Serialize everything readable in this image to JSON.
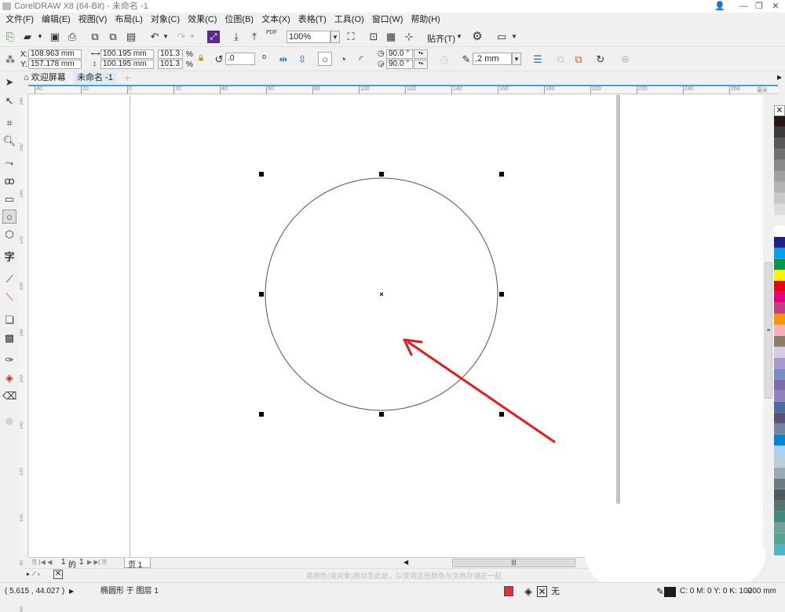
{
  "window": {
    "title": "CorelDRAW X8 (64-Bit) - 未命名 -1"
  },
  "menu": [
    "文件(F)",
    "编辑(E)",
    "视图(V)",
    "布局(L)",
    "对象(C)",
    "效果(C)",
    "位图(B)",
    "文本(X)",
    "表格(T)",
    "工具(O)",
    "窗口(W)",
    "帮助(H)"
  ],
  "standard_toolbar": {
    "zoom_level": "100%",
    "snap_label": "贴齐(T)",
    "pdf_label": "PDF"
  },
  "property_bar": {
    "x": "108.963 mm",
    "y": "157.178 mm",
    "x_label": "X:",
    "y_label": "Y:",
    "width": "100.195 mm",
    "height": "100.195 mm",
    "scale_w": "101.3",
    "scale_h": "101.3",
    "percent": "%",
    "rotation": ".0",
    "start_angle": "90.0 °",
    "end_angle": "90.0 °",
    "outline_width": ".2 mm"
  },
  "tabs": [
    {
      "label": "欢迎屏幕",
      "icon": "home-icon"
    },
    {
      "label": "未命名 -1",
      "active": true
    }
  ],
  "ruler": {
    "h_ticks": [
      "40",
      "20",
      "0",
      "20",
      "40",
      "60",
      "80",
      "100",
      "120",
      "140",
      "160",
      "180",
      "200",
      "220",
      "240",
      "260"
    ],
    "unit": "毫米",
    "v_ticks": [
      "280",
      "260",
      "240",
      "220",
      "200",
      "180",
      "160",
      "140",
      "120",
      "100",
      "80",
      "60"
    ]
  },
  "page_nav": {
    "current": "1",
    "of": "的",
    "total": "1",
    "page_tab": "页 1"
  },
  "palette_tray": {
    "hint": "将颜色(或对象)拖动至此处，以便将这些颜色与文档存储在一起"
  },
  "palette": [
    "#231815",
    "#3e3a39",
    "#595757",
    "#727171",
    "#898989",
    "#9fa0a0",
    "#b5b5b6",
    "#c9caca",
    "#dcdddd",
    "#efefef",
    "#ffffff",
    "#1d2088",
    "#00a0e9",
    "#009944",
    "#fff100",
    "#e60012",
    "#e4007f",
    "#c13e83",
    "#f39800",
    "#f5b2b2",
    "#8c7a6b",
    "#d3cce6",
    "#a59aca",
    "#7a8cc6",
    "#7d6bb0",
    "#8f82bc",
    "#4c6ca0",
    "#5a5478",
    "#73879c",
    "#0086d1",
    "#a3d5f2",
    "#b9cdd6",
    "#9aabb2",
    "#6d7c83",
    "#4d5a5e",
    "#57746f",
    "#3f8a79",
    "#6fa39a",
    "#53a590",
    "#4db6c6"
  ],
  "status": {
    "cursor": "( 5.615 , 44.027 )",
    "object_info": "椭圆形 于 图层 1",
    "fill_none": "无",
    "outline_color": "C: 0 M: 0 Y: 0 K: 100",
    "outline_width": ".200 mm"
  },
  "colors": {
    "accent": "#3aa6de",
    "annotation_arrow": "#e51b1b",
    "selection_handle": "#000000"
  }
}
